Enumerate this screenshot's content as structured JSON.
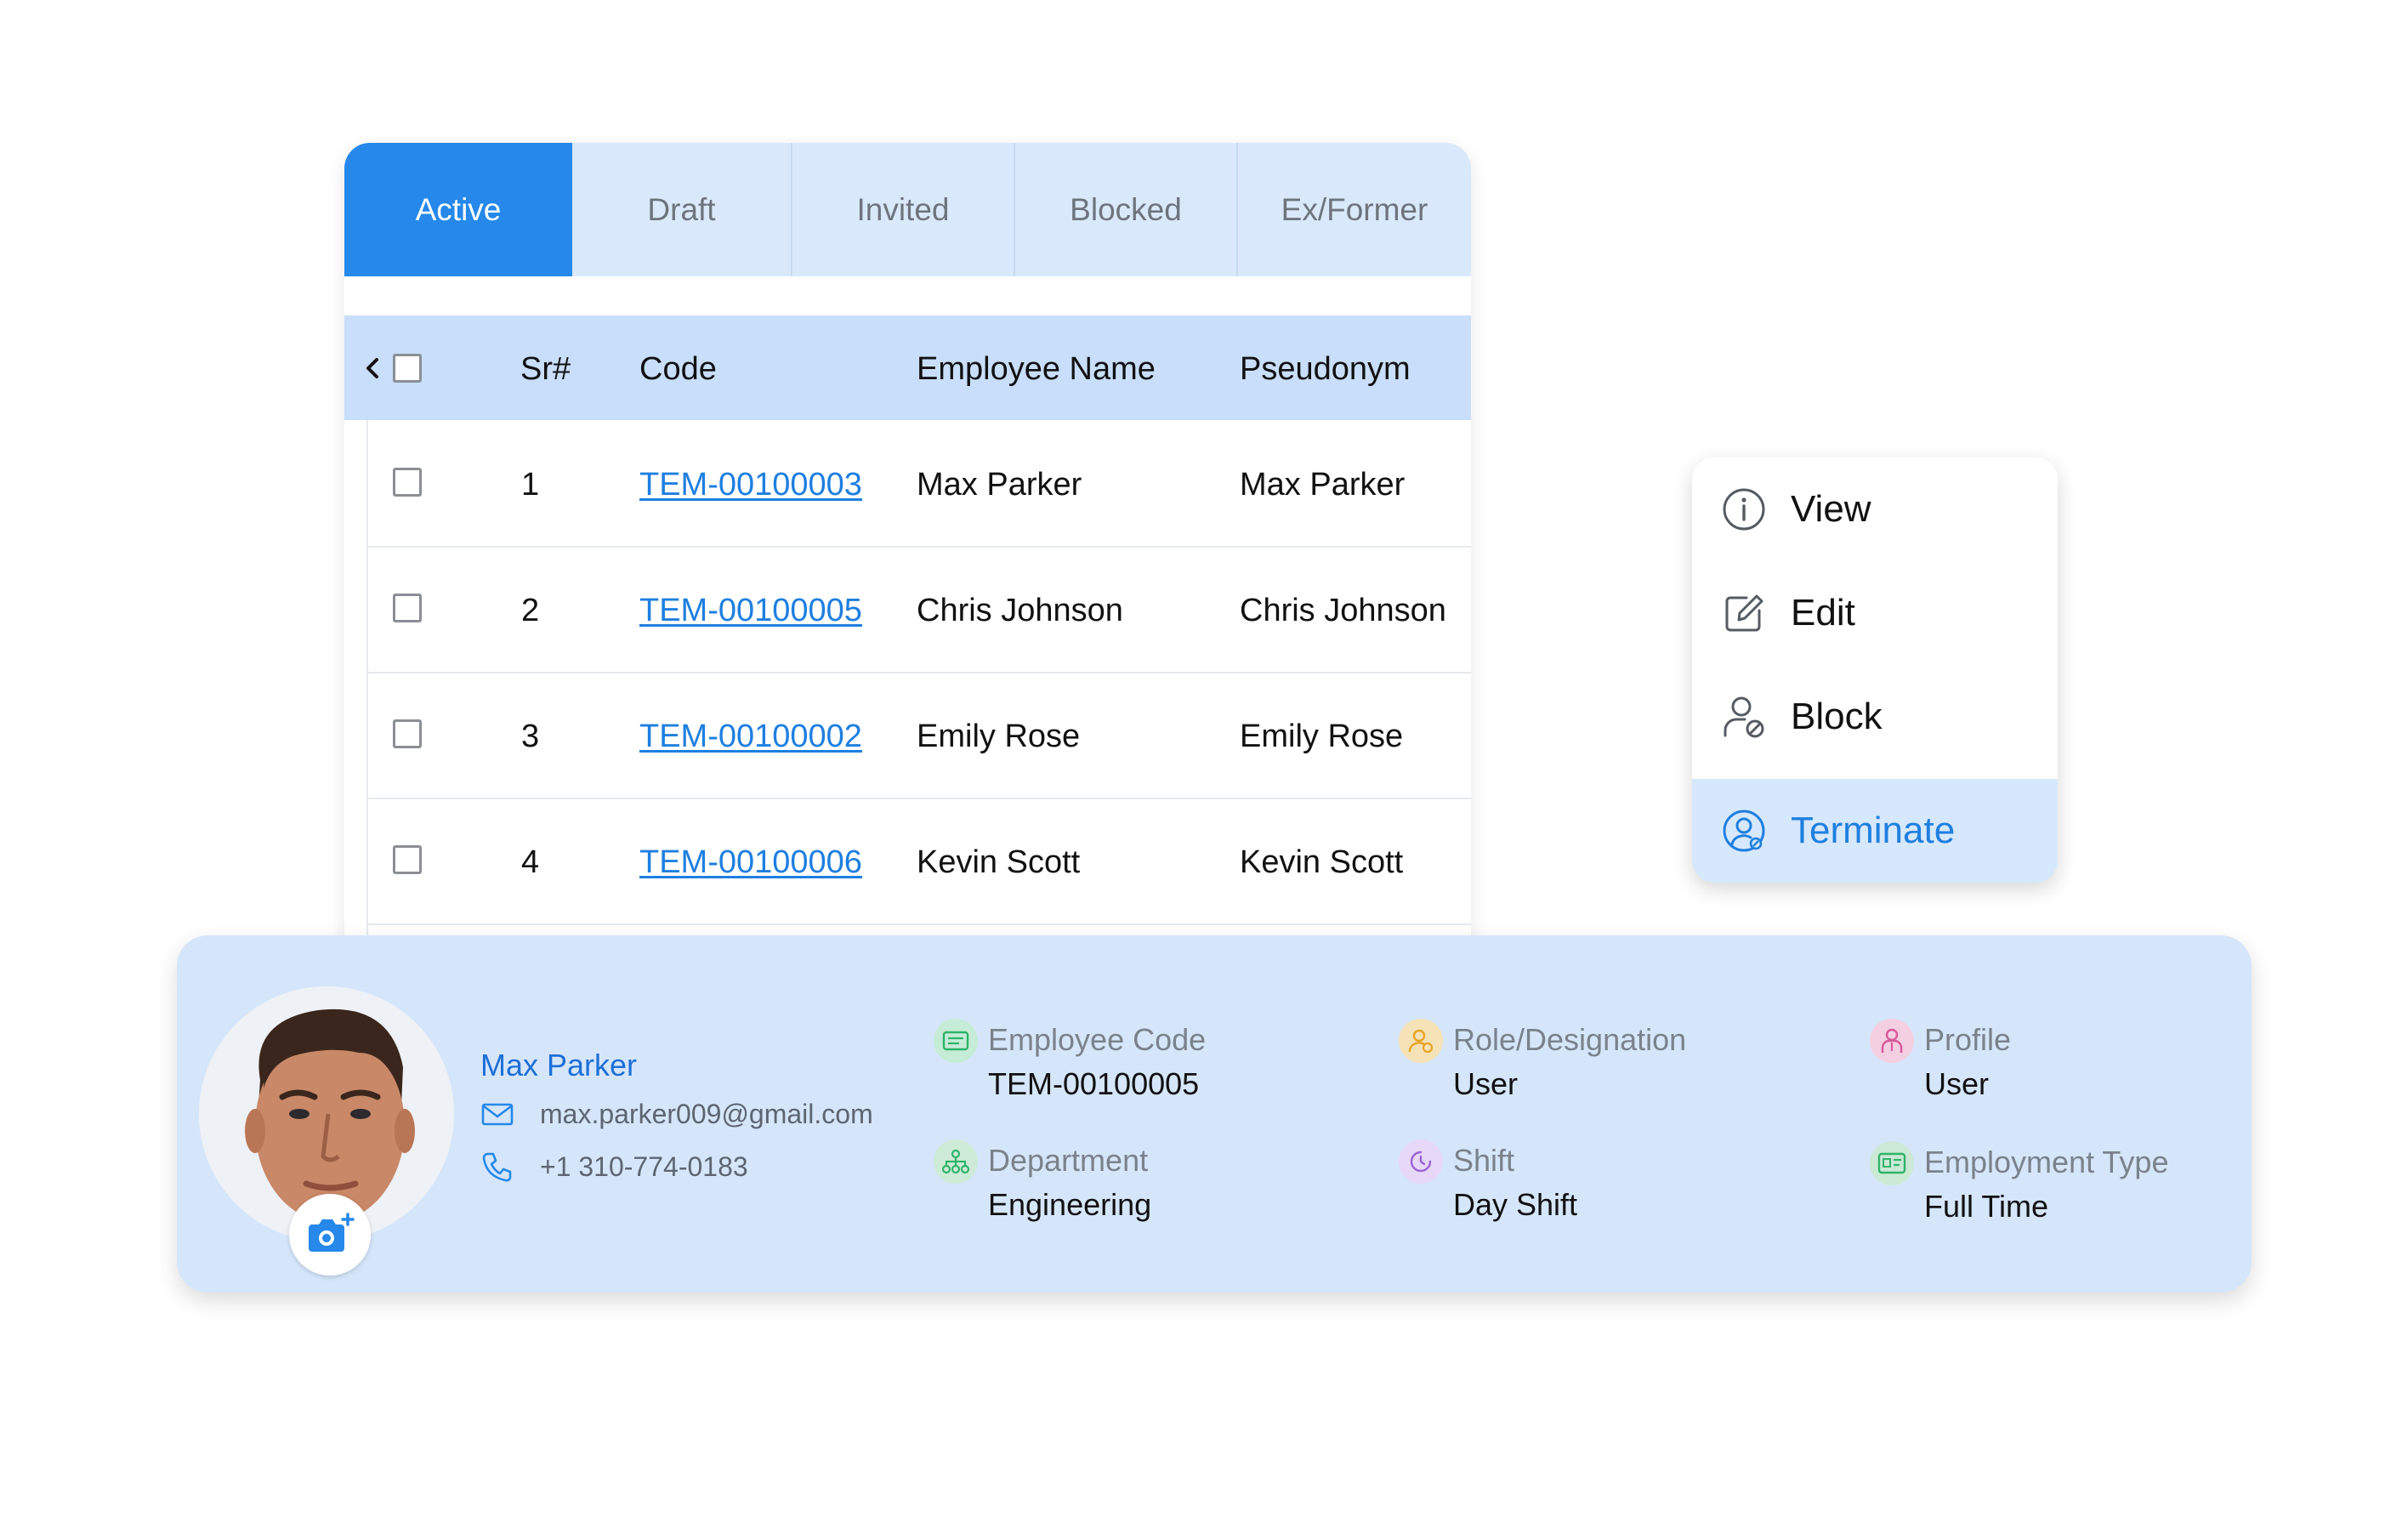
{
  "tabs": [
    {
      "label": "Active",
      "active": true
    },
    {
      "label": "Draft",
      "active": false
    },
    {
      "label": "Invited",
      "active": false
    },
    {
      "label": "Blocked",
      "active": false
    },
    {
      "label": "Ex/Former",
      "active": false
    }
  ],
  "table": {
    "columns": [
      "Sr#",
      "Code",
      "Employee Name",
      "Pseudonym"
    ],
    "rows": [
      {
        "sr": "1",
        "code": "TEM-00100003",
        "name": "Max Parker",
        "pseudonym": "Max Parker"
      },
      {
        "sr": "2",
        "code": "TEM-00100005",
        "name": "Chris Johnson",
        "pseudonym": "Chris Johnson"
      },
      {
        "sr": "3",
        "code": "TEM-00100002",
        "name": "Emily Rose",
        "pseudonym": "Emily Rose"
      },
      {
        "sr": "4",
        "code": "TEM-00100006",
        "name": "Kevin Scott",
        "pseudonym": "Kevin Scott"
      }
    ]
  },
  "menu": {
    "items": [
      {
        "label": "View",
        "icon": "info-icon"
      },
      {
        "label": "Edit",
        "icon": "edit-icon"
      },
      {
        "label": "Block",
        "icon": "block-user-icon"
      },
      {
        "label": "Terminate",
        "icon": "terminate-user-icon",
        "highlighted": true
      }
    ]
  },
  "profile": {
    "name": "Max Parker",
    "email": "max.parker009@gmail.com",
    "phone": "+1 310-774-0183",
    "fields": {
      "employee_code": {
        "label": "Employee Code",
        "value": "TEM-00100005",
        "icon": "id-card-icon"
      },
      "role": {
        "label": "Role/Designation",
        "value": "User",
        "icon": "role-user-icon"
      },
      "profile": {
        "label": "Profile",
        "value": "User",
        "icon": "profile-person-icon"
      },
      "department": {
        "label": "Department",
        "value": "Engineering",
        "icon": "department-tree-icon"
      },
      "shift": {
        "label": "Shift",
        "value": "Day Shift",
        "icon": "shift-clock-icon"
      },
      "employment_type": {
        "label": "Employment Type",
        "value": "Full Time",
        "icon": "employment-card-icon"
      }
    }
  },
  "colors": {
    "accent": "#2588ea",
    "link": "#1e7fe0",
    "tab_bg": "#d9e9fb",
    "header_bg": "#c8defa",
    "card_bg": "#d5e6fb"
  }
}
